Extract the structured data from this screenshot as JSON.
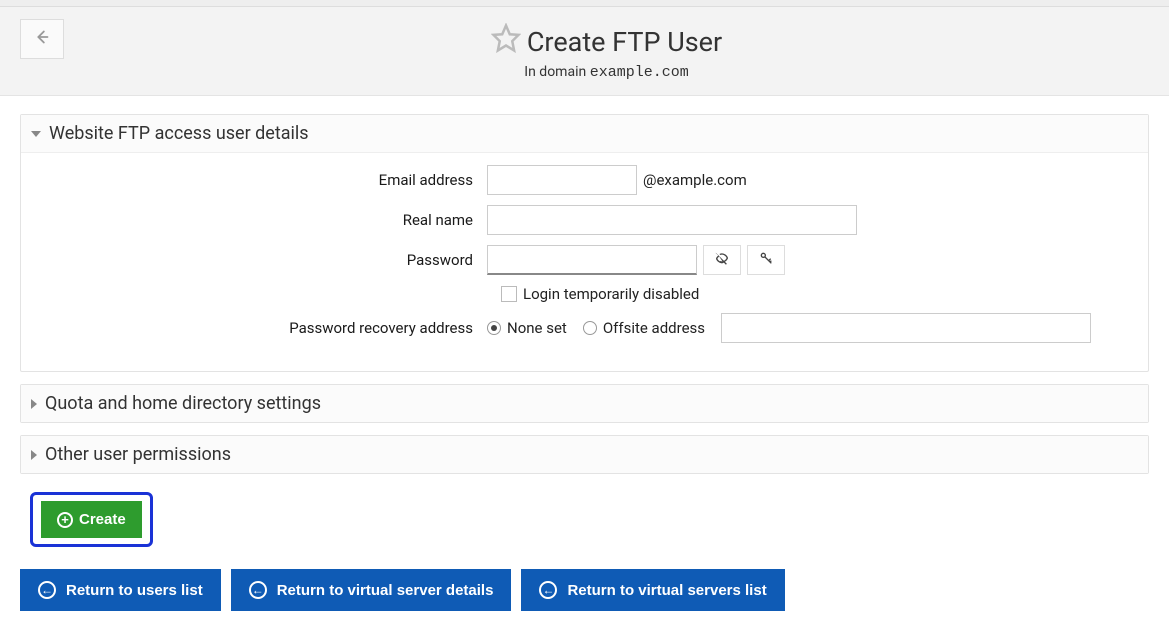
{
  "header": {
    "title": "Create FTP User",
    "sub_prefix": "In domain ",
    "domain": "example.com"
  },
  "panels": {
    "details": {
      "title": "Website FTP access user details",
      "fields": {
        "email_label": "Email address",
        "email_suffix": "@example.com",
        "realname_label": "Real name",
        "password_label": "Password",
        "login_disabled_label": "Login temporarily disabled",
        "recovery_label": "Password recovery address",
        "recovery_none": "None set",
        "recovery_offsite": "Offsite address"
      }
    },
    "quota": {
      "title": "Quota and home directory settings"
    },
    "perms": {
      "title": "Other user permissions"
    }
  },
  "actions": {
    "create": "Create",
    "return_users": "Return to users list",
    "return_vserver": "Return to virtual server details",
    "return_vservers": "Return to virtual servers list"
  }
}
